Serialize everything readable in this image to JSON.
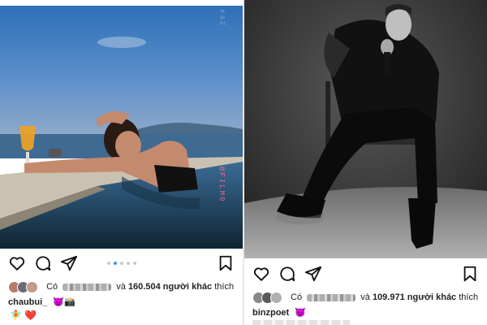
{
  "left_post": {
    "photo_label": "@FILM0",
    "corner_label": "#4Z",
    "carousel": {
      "count": 5,
      "active": 1
    },
    "likes": {
      "prefix": "Có",
      "conj": "và",
      "count": "160.504",
      "suffix": "người khác",
      "verb": "thích"
    },
    "caption": {
      "username": "chaubui_",
      "emojis": "😈📸"
    },
    "extra_line": {
      "fairy": "🧚",
      "heart": "❤️"
    },
    "avatar_colors": [
      "#b67b6a",
      "#6a6a78",
      "#c49a8a"
    ]
  },
  "right_post": {
    "likes": {
      "prefix": "Có",
      "conj": "và",
      "count": "109.971",
      "suffix": "người khác",
      "verb": "thích"
    },
    "caption": {
      "username": "binzpoet",
      "emojis": "😈"
    },
    "avatar_colors": [
      "#888888",
      "#5a5a5a",
      "#b0b0b0"
    ]
  },
  "colors": {
    "icon": "#111111",
    "accent": "#3797f0"
  }
}
